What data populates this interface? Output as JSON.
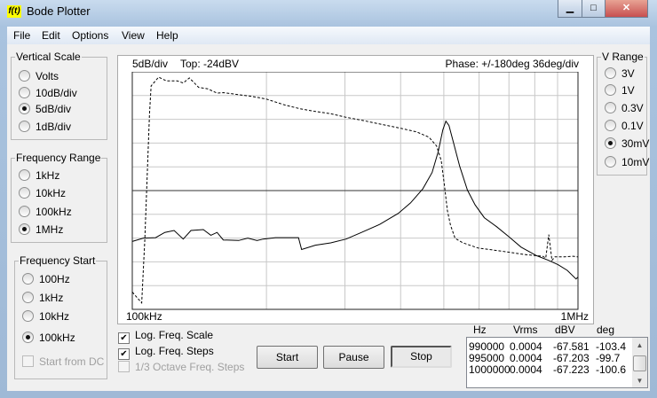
{
  "window": {
    "title": "Bode Plotter",
    "logo_text": "f(t)",
    "minimize": "▁",
    "maximize": "□",
    "close": "✕"
  },
  "menu": [
    "File",
    "Edit",
    "Options",
    "View",
    "Help"
  ],
  "vertical_scale": {
    "label": "Vertical Scale",
    "options": [
      "Volts",
      "10dB/div",
      "5dB/div",
      "1dB/div"
    ],
    "selected": 2
  },
  "frequency_range": {
    "label": "Frequency Range",
    "options": [
      "1kHz",
      "10kHz",
      "100kHz",
      "1MHz"
    ],
    "selected": 3
  },
  "frequency_start": {
    "label": "Frequency Start",
    "options": [
      "100Hz",
      "1kHz",
      "10kHz",
      "100kHz"
    ],
    "selected": 3,
    "start_from_dc": "Start from DC"
  },
  "v_range": {
    "label": "V Range",
    "options": [
      "3V",
      "1V",
      "0.3V",
      "0.1V",
      "30mV",
      "10mV"
    ],
    "selected": 4
  },
  "plot": {
    "scale_label": "5dB/div",
    "top_label": "Top: -24dBV",
    "phase_label": "Phase: +/-180deg  36deg/div",
    "x_start": "100kHz",
    "x_end": "1MHz"
  },
  "checkboxes": [
    {
      "label": "Log. Freq. Scale",
      "checked": true,
      "enabled": true
    },
    {
      "label": "Log. Freq. Steps",
      "checked": true,
      "enabled": true
    },
    {
      "label": "1/3 Octave Freq. Steps",
      "checked": false,
      "enabled": false
    }
  ],
  "buttons": {
    "start": "Start",
    "pause": "Pause",
    "stop": "Stop"
  },
  "table": {
    "headers": [
      "Hz",
      "Vrms",
      "dBV",
      "deg"
    ],
    "rows": [
      [
        "990000",
        "0.0004",
        "-67.581",
        "-103.4"
      ],
      [
        "995000",
        "0.0004",
        "-67.203",
        "-99.7"
      ],
      [
        "1000000",
        "0.0004",
        "-67.223",
        "-100.6"
      ]
    ]
  },
  "chart_data": {
    "type": "line",
    "x_scale": "log",
    "x_unit": "kHz",
    "xlim": [
      100,
      1000
    ],
    "y_left": {
      "unit": "dBV",
      "top": -24,
      "per_div": 5,
      "divisions": 10,
      "range": [
        -74,
        -24
      ]
    },
    "y_phase": {
      "unit": "deg",
      "range": [
        -180,
        180
      ],
      "per_div": 36
    },
    "grid": true,
    "series": [
      {
        "style": "solid",
        "axis": "dBV",
        "points": [
          [
            100,
            -59.7
          ],
          [
            105.9,
            -59.0
          ],
          [
            112.8,
            -58.9
          ],
          [
            118.3,
            -57.8
          ],
          [
            124.1,
            -57.4
          ],
          [
            130.1,
            -59.2
          ],
          [
            135.4,
            -57.4
          ],
          [
            144.3,
            -57.2
          ],
          [
            150.1,
            -58.4
          ],
          [
            155,
            -57.8
          ],
          [
            160,
            -59.4
          ],
          [
            173.2,
            -59.5
          ],
          [
            181.6,
            -59.0
          ],
          [
            190.5,
            -59.5
          ],
          [
            196.6,
            -59.2
          ],
          [
            209.6,
            -58.9
          ],
          [
            236,
            -58.9
          ],
          [
            239.8,
            -61.4
          ],
          [
            257.5,
            -60.5
          ],
          [
            278.8,
            -60.0
          ],
          [
            301.8,
            -59.2
          ],
          [
            326.8,
            -57.8
          ],
          [
            359.3,
            -56.1
          ],
          [
            395.2,
            -53.8
          ],
          [
            421.1,
            -51.6
          ],
          [
            448.7,
            -48.6
          ],
          [
            470.6,
            -45.2
          ],
          [
            485.8,
            -40.8
          ],
          [
            497.5,
            -36.2
          ],
          [
            505.4,
            -34.4
          ],
          [
            513.5,
            -35.3
          ],
          [
            525.9,
            -39.0
          ],
          [
            542.9,
            -43.9
          ],
          [
            564.9,
            -48.9
          ],
          [
            587.7,
            -52.0
          ],
          [
            616.3,
            -54.7
          ],
          [
            656.7,
            -56.6
          ],
          [
            699.6,
            -58.7
          ],
          [
            745.4,
            -60.9
          ],
          [
            807.2,
            -62.7
          ],
          [
            860.1,
            -63.7
          ],
          [
            902.1,
            -64.6
          ],
          [
            946,
            -65.8
          ],
          [
            990,
            -67.6
          ],
          [
            1000,
            -67.2
          ]
        ]
      },
      {
        "style": "dashed",
        "axis": "deg",
        "points": [
          [
            100,
            -153.8
          ],
          [
            105,
            -170.2
          ],
          [
            106.7,
            -74.7
          ],
          [
            109.3,
            116.4
          ],
          [
            110.2,
            158.7
          ],
          [
            114.6,
            172
          ],
          [
            119.3,
            166.2
          ],
          [
            126.1,
            166.2
          ],
          [
            130.1,
            163.1
          ],
          [
            134.3,
            170.7
          ],
          [
            140.9,
            156.4
          ],
          [
            147.7,
            154.2
          ],
          [
            155,
            147.6
          ],
          [
            160,
            148.4
          ],
          [
            173.2,
            145.3
          ],
          [
            184.5,
            143.1
          ],
          [
            199.7,
            138.7
          ],
          [
            219.7,
            129.8
          ],
          [
            237.8,
            124
          ],
          [
            257.5,
            120
          ],
          [
            278.8,
            116.4
          ],
          [
            301.8,
            111.1
          ],
          [
            326.8,
            106.7
          ],
          [
            359.3,
            100.9
          ],
          [
            401.5,
            94.2
          ],
          [
            434.6,
            88.9
          ],
          [
            463.2,
            80.9
          ],
          [
            481.9,
            67.6
          ],
          [
            493.5,
            45.3
          ],
          [
            501.3,
            9.8
          ],
          [
            509.4,
            -30.2
          ],
          [
            517.6,
            -52.4
          ],
          [
            530,
            -72.4
          ],
          [
            551.6,
            -79.1
          ],
          [
            597,
            -87.1
          ],
          [
            646.3,
            -90.2
          ],
          [
            699.6,
            -93.3
          ],
          [
            757.6,
            -96.9
          ],
          [
            833.2,
            -99.6
          ],
          [
            846.6,
            -102.2
          ],
          [
            860.1,
            -66.7
          ],
          [
            874.1,
            -105.8
          ],
          [
            888.1,
            -100.4
          ],
          [
            931.1,
            -100.4
          ],
          [
            976.5,
            -99.6
          ],
          [
            1000,
            -100.6
          ]
        ]
      }
    ]
  }
}
